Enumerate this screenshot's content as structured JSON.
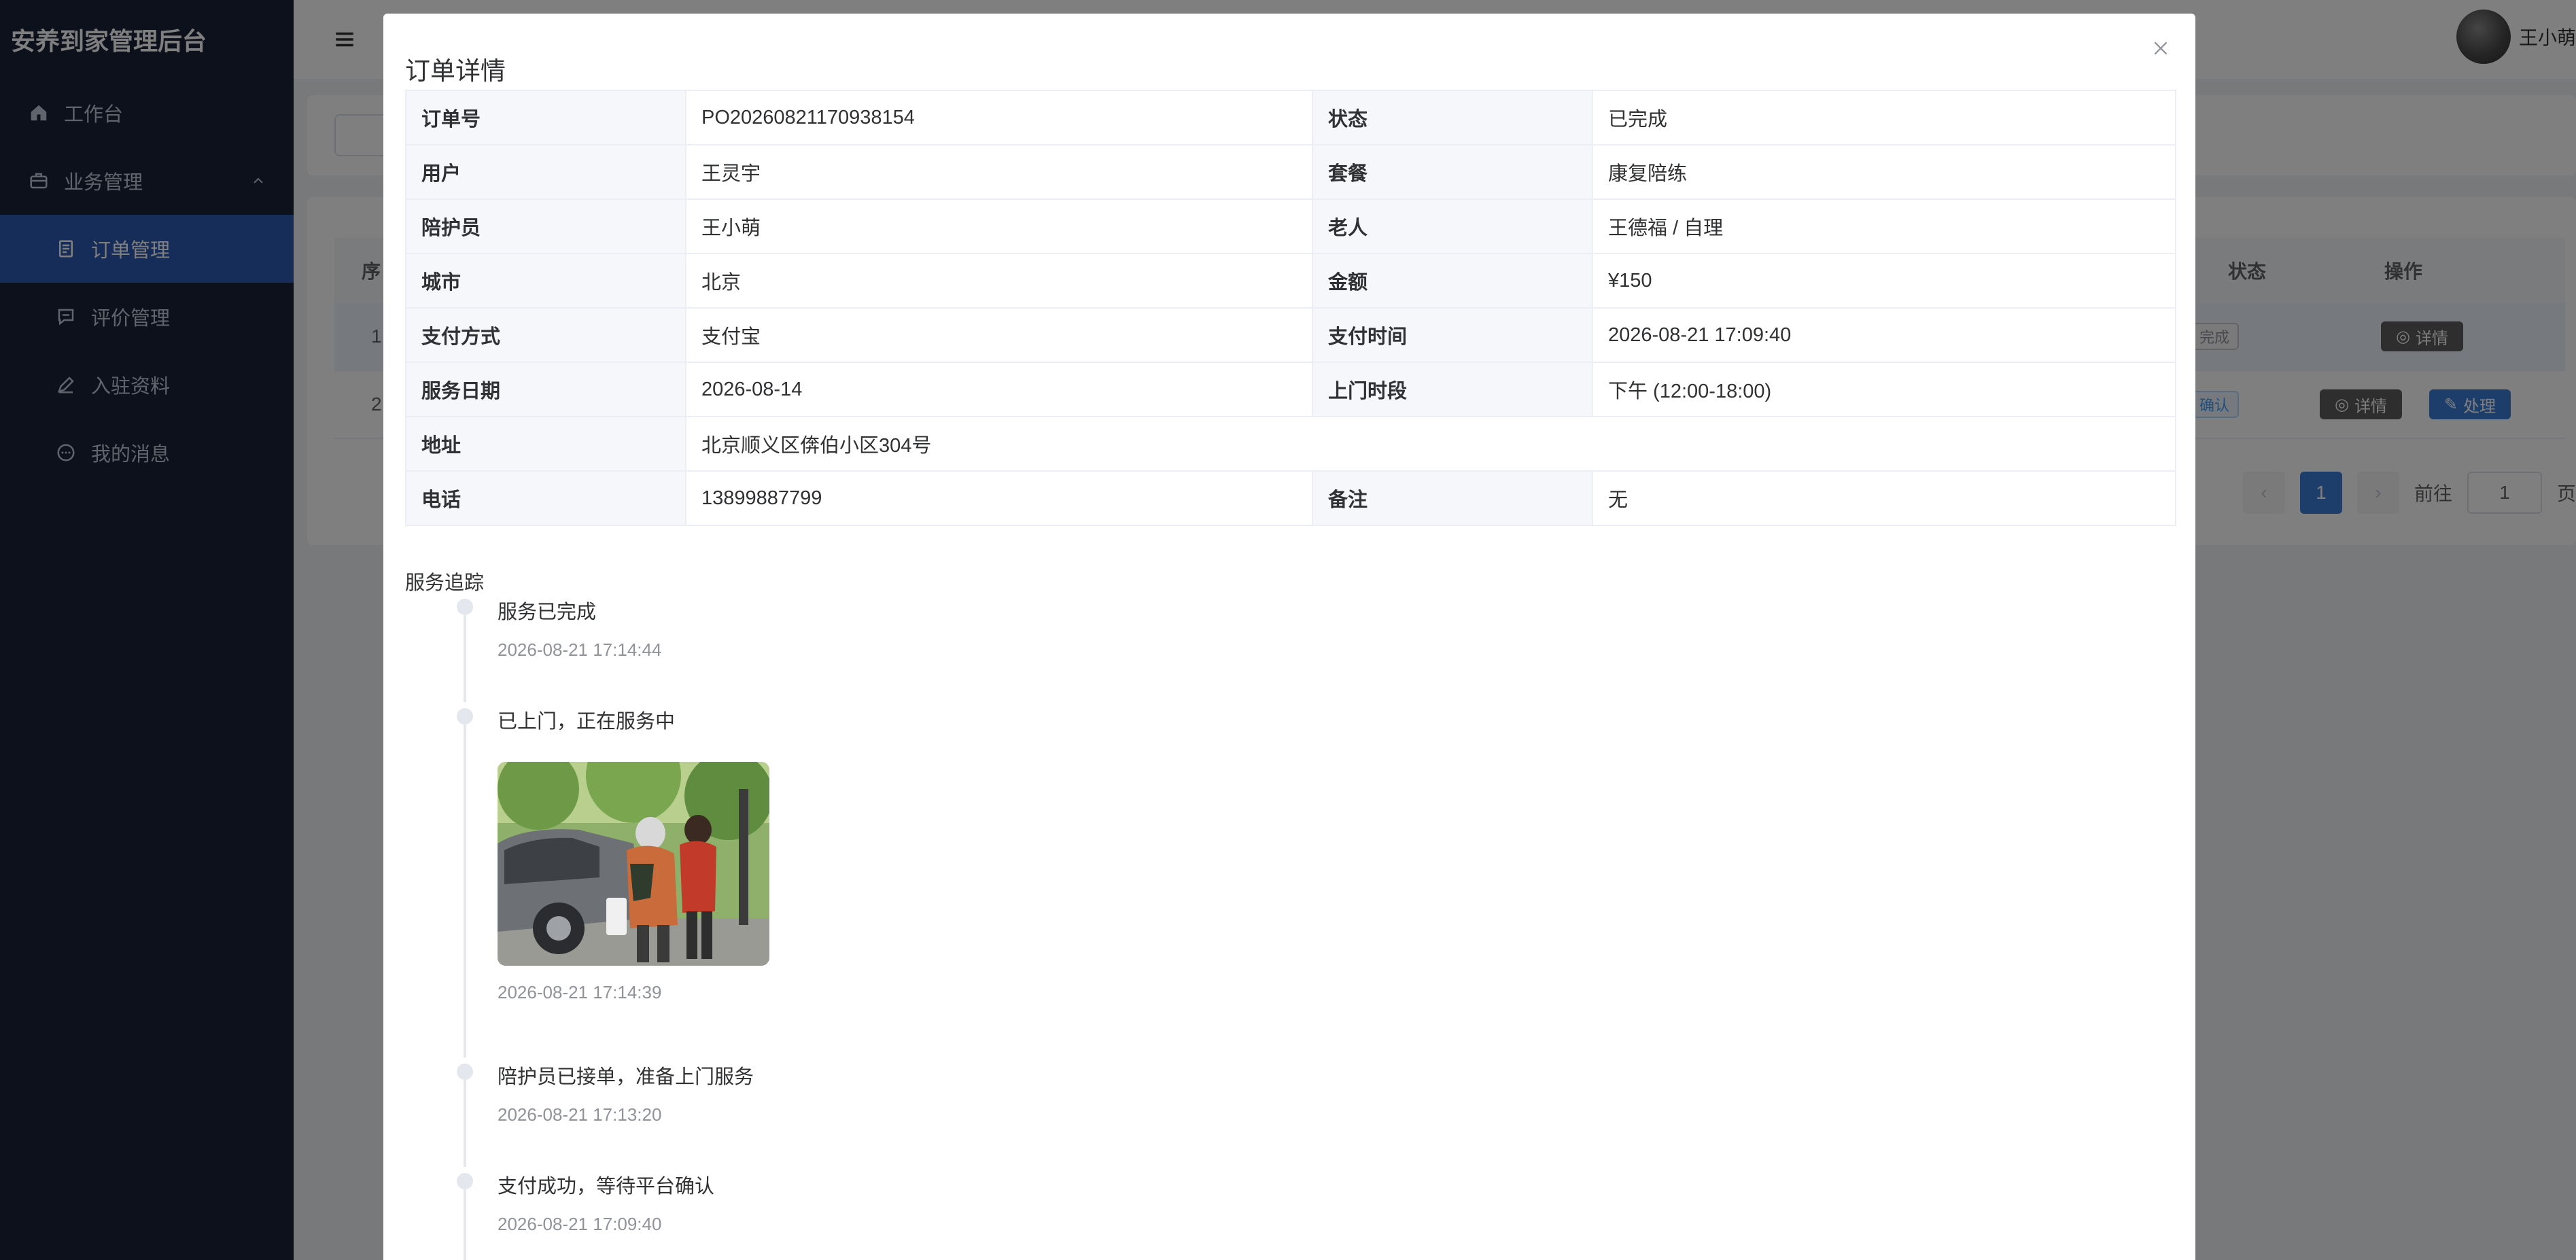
{
  "app": {
    "brand": "安养到家管理后台"
  },
  "sidebar": {
    "items": [
      {
        "label": "工作台",
        "icon": "home-icon"
      },
      {
        "label": "业务管理",
        "icon": "briefcase-icon"
      },
      {
        "label": "订单管理",
        "icon": "document-icon",
        "active": true
      },
      {
        "label": "评价管理",
        "icon": "comment-icon"
      },
      {
        "label": "入驻资料",
        "icon": "edit-icon"
      },
      {
        "label": "我的消息",
        "icon": "chat-icon"
      }
    ]
  },
  "header": {
    "user_name": "王小萌"
  },
  "background_table": {
    "col_index": "序",
    "col_status": "状态",
    "col_operation": "操作",
    "rows": [
      {
        "index": "1",
        "status": "完成",
        "detail": "详情"
      },
      {
        "index": "2",
        "status": "确认",
        "detail": "详情",
        "handle": "处理"
      }
    ],
    "pager": {
      "current": "1",
      "goto_label": "前往",
      "goto_value": "1",
      "page_suffix": "页"
    }
  },
  "dialog": {
    "title": "订单详情",
    "fields": {
      "order_no_label": "订单号",
      "order_no": "PO20260821170938154",
      "status_label": "状态",
      "status": "已完成",
      "user_label": "用户",
      "user": "王灵宇",
      "package_label": "套餐",
      "package": "康复陪练",
      "escort_label": "陪护员",
      "escort": "王小萌",
      "elder_label": "老人",
      "elder": "王德福 / 自理",
      "city_label": "城市",
      "city": "北京",
      "amount_label": "金额",
      "amount": "¥150",
      "pay_method_label": "支付方式",
      "pay_method": "支付宝",
      "pay_time_label": "支付时间",
      "pay_time": "2026-08-21 17:09:40",
      "service_date_label": "服务日期",
      "service_date": "2026-08-14",
      "visit_slot_label": "上门时段",
      "visit_slot": "下午 (12:00-18:00)",
      "address_label": "地址",
      "address": "北京顺义区倴伯小区304号",
      "phone_label": "电话",
      "phone": "13899887799",
      "remark_label": "备注",
      "remark": "无"
    },
    "tracking_title": "服务追踪",
    "timeline": [
      {
        "content": "服务已完成",
        "time": "2026-08-21 17:14:44"
      },
      {
        "content": "已上门，正在服务中",
        "time": "2026-08-21 17:14:39"
      },
      {
        "content": "陪护员已接单，准备上门服务",
        "time": "2026-08-21 17:13:20"
      },
      {
        "content": "支付成功，等待平台确认",
        "time": "2026-08-21 17:09:40"
      }
    ]
  },
  "colors": {
    "sidebar_bg": "#1a2238",
    "accent": "#2d5bb5",
    "label_bg": "#f5f7fa"
  }
}
